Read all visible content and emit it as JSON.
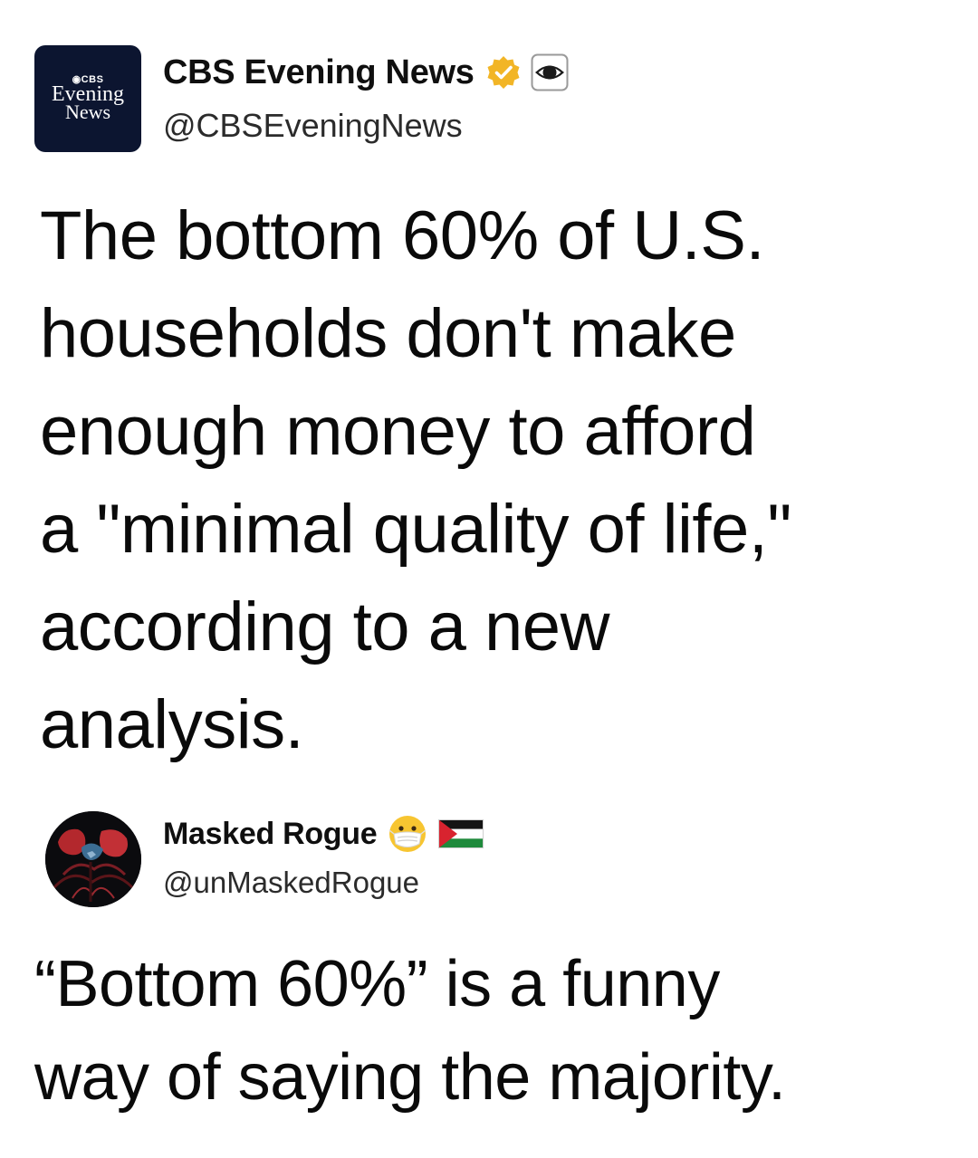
{
  "tweet_1": {
    "avatar": {
      "logo_top": "◉CBS",
      "logo_mid": "Evening",
      "logo_bottom": "News",
      "background_color": "#0c1530"
    },
    "display_name": "CBS Evening News",
    "handle": "@CBSEveningNews",
    "badges": [
      "verified-gold-check-icon",
      "cbs-eye-icon"
    ],
    "badge_color": "#f2b526",
    "text_lines": [
      "The bottom 60% of U.S.",
      "households don't make",
      "enough money to afford",
      "a \"minimal quality of life,\"",
      "according to a new",
      "analysis."
    ]
  },
  "tweet_2": {
    "avatar": {
      "icon": "masked-figure-avatar-icon"
    },
    "display_name": "Masked Rogue",
    "handle": "@unMaskedRogue",
    "badges": [
      "face-with-medical-mask-emoji",
      "palestine-flag-icon"
    ],
    "text_lines": [
      "“Bottom 60%” is a funny",
      "way of saying the majority."
    ]
  }
}
